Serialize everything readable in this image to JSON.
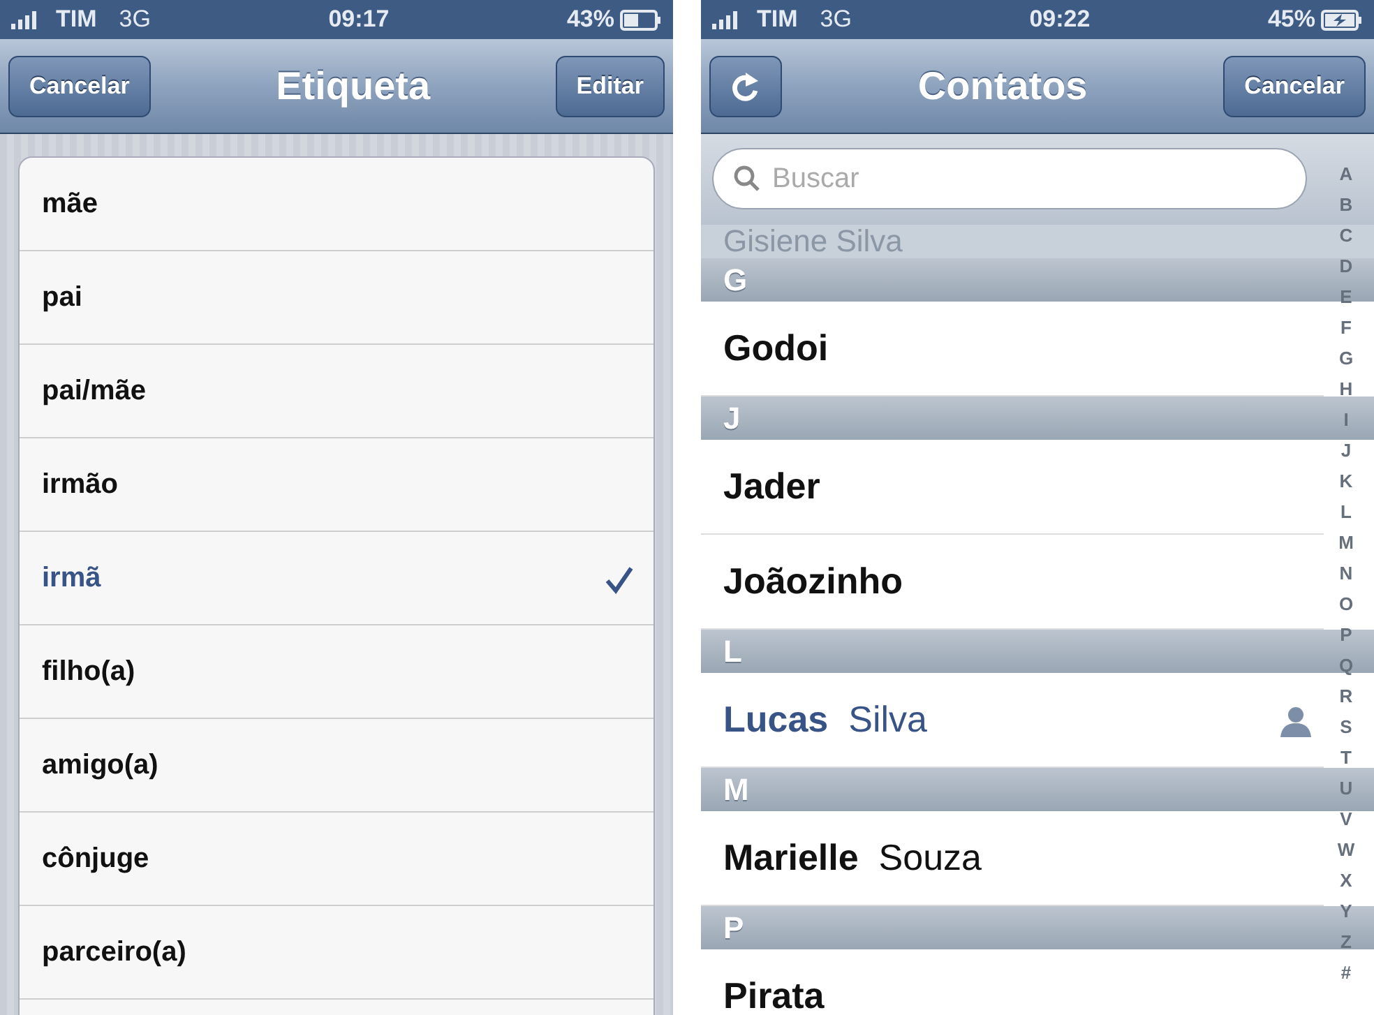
{
  "screens": [
    {
      "status_bar": {
        "carrier": "TIM",
        "network": "3G",
        "time": "09:17",
        "battery": "43%",
        "charging": false
      },
      "nav_bar": {
        "left_button": {
          "kind": "text",
          "label": "Cancelar"
        },
        "title": "Etiqueta",
        "right_button": {
          "kind": "text",
          "label": "Editar"
        }
      },
      "labels": [
        {
          "label": "mãe",
          "selected": false
        },
        {
          "label": "pai",
          "selected": false
        },
        {
          "label": "pai/mãe",
          "selected": false
        },
        {
          "label": "irmão",
          "selected": false
        },
        {
          "label": "irmã",
          "selected": true
        },
        {
          "label": "filho(a)",
          "selected": false
        },
        {
          "label": "amigo(a)",
          "selected": false
        },
        {
          "label": "cônjuge",
          "selected": false
        },
        {
          "label": "parceiro(a)",
          "selected": false
        }
      ]
    },
    {
      "status_bar": {
        "carrier": "TIM",
        "network": "3G",
        "time": "09:22",
        "battery": "45%",
        "charging": true
      },
      "nav_bar": {
        "left_button": {
          "kind": "refresh"
        },
        "title": "Contatos",
        "right_button": {
          "kind": "text",
          "label": "Cancelar"
        }
      },
      "search": {
        "placeholder": "Buscar"
      },
      "contacts": [
        {
          "kind": "faded",
          "first": "Gisiene",
          "last": "Silva"
        },
        {
          "kind": "header",
          "letter": "G"
        },
        {
          "kind": "contact",
          "first": "Godoi",
          "selected": false
        },
        {
          "kind": "header",
          "letter": "J"
        },
        {
          "kind": "contact",
          "first": "Jader",
          "selected": false
        },
        {
          "kind": "contact",
          "first": "Joãozinho",
          "selected": false
        },
        {
          "kind": "header",
          "letter": "L"
        },
        {
          "kind": "contact",
          "first": "Lucas",
          "last": "Silva",
          "selected": true
        },
        {
          "kind": "header",
          "letter": "M"
        },
        {
          "kind": "contact",
          "first": "Marielle",
          "last": "Souza",
          "selected": false
        },
        {
          "kind": "header",
          "letter": "P"
        },
        {
          "kind": "contact",
          "first": "Pirata",
          "selected": false
        }
      ],
      "index": [
        "A",
        "B",
        "C",
        "D",
        "E",
        "F",
        "G",
        "H",
        "I",
        "J",
        "K",
        "L",
        "M",
        "N",
        "O",
        "P",
        "Q",
        "R",
        "S",
        "T",
        "U",
        "V",
        "W",
        "X",
        "Y",
        "Z",
        "#"
      ]
    }
  ]
}
